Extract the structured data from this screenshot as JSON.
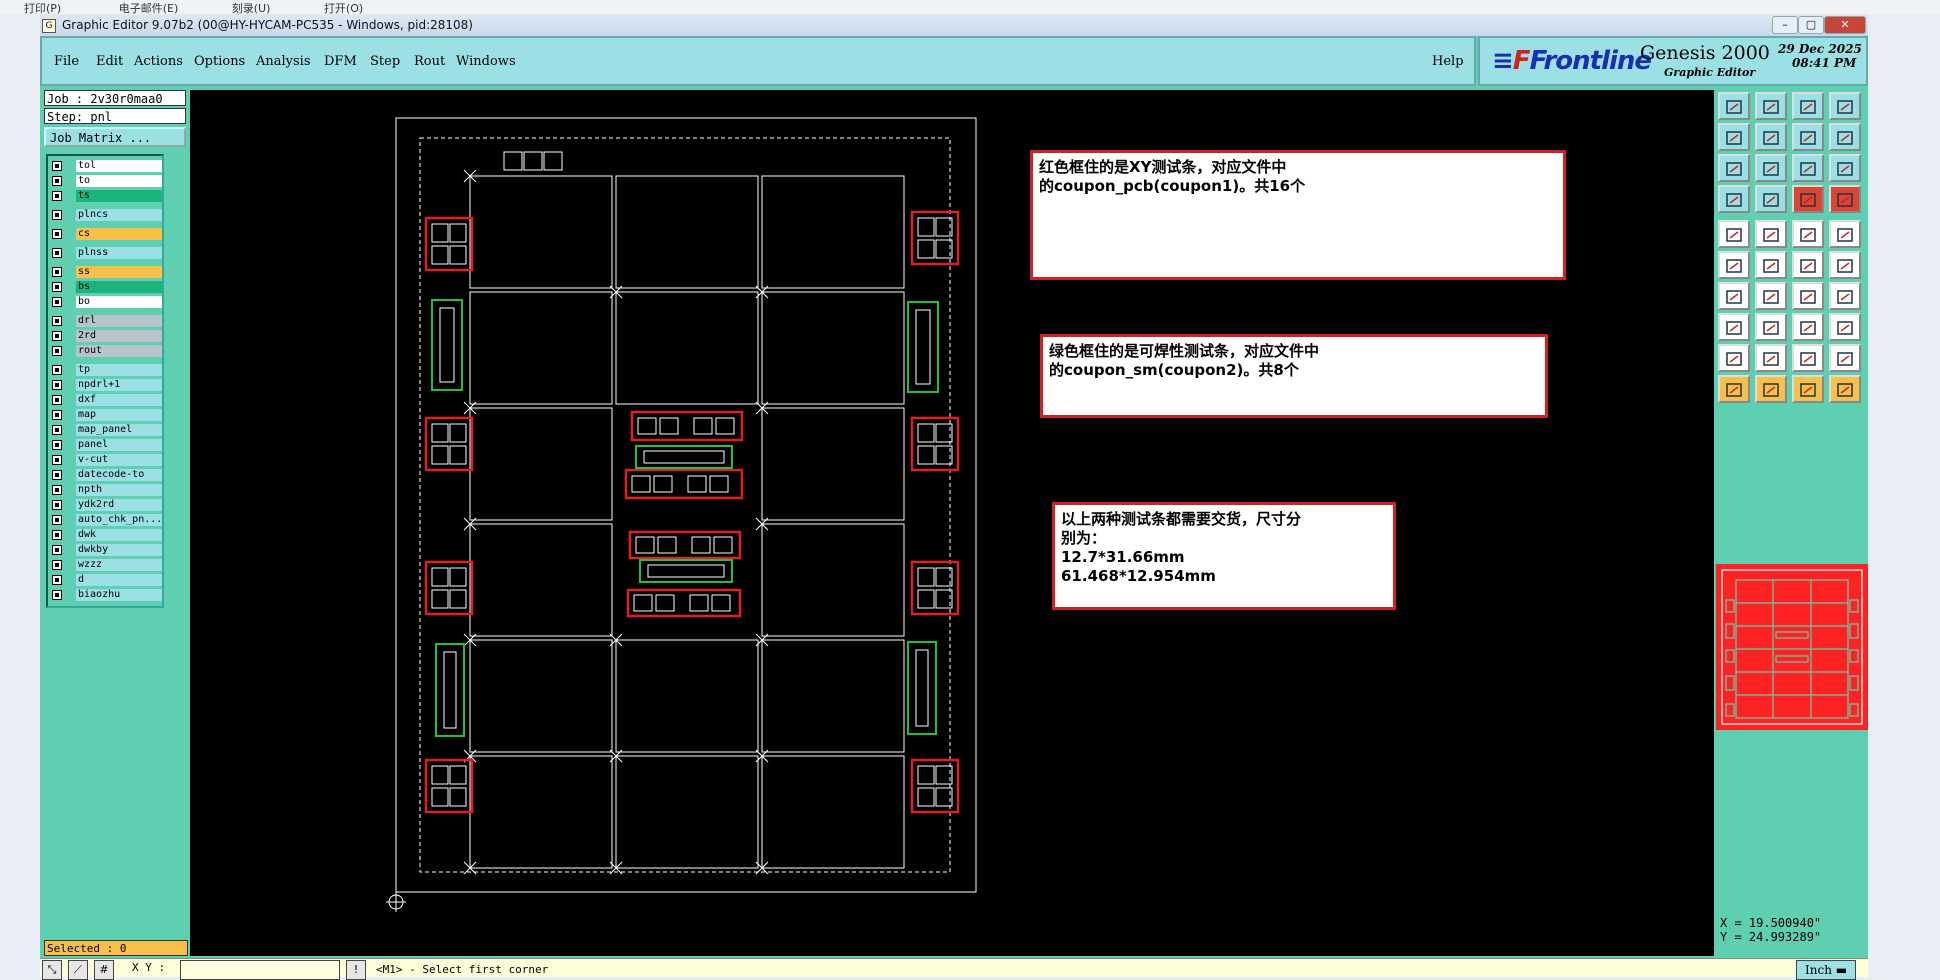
{
  "os_menu": [
    "打印(P)",
    "电子邮件(E)",
    "刻录(U)",
    "打开(O)"
  ],
  "window": {
    "title": "Graphic Editor 9.07b2 (00@HY-HYCAM-PC535 - Windows, pid:28108)"
  },
  "menu": {
    "items": [
      "File",
      "Edit",
      "Actions",
      "Options",
      "Analysis",
      "DFM",
      "Step",
      "Rout",
      "Windows"
    ],
    "help": "Help"
  },
  "logo": {
    "brand": "Frontline",
    "product": "Genesis 2000",
    "subtitle": "Graphic Editor",
    "date": "29 Dec 2025",
    "time": "08:41 PM"
  },
  "job": {
    "job_line": "Job : 2v30r0maa0",
    "step_line": "Step: pnl",
    "matrix_button": "Job Matrix ..."
  },
  "layers": [
    {
      "name": "tol",
      "color": "#ffffff"
    },
    {
      "name": "to",
      "color": "#ffffff"
    },
    {
      "name": "ts",
      "color": "#1bb57c"
    },
    {
      "name": "plncs",
      "color": "#9be0e4"
    },
    {
      "name": "cs",
      "color": "#f7c04a"
    },
    {
      "name": "plnss",
      "color": "#9be0e4"
    },
    {
      "name": "ss",
      "color": "#f7c04a"
    },
    {
      "name": "bs",
      "color": "#1bb57c"
    },
    {
      "name": "bo",
      "color": "#ffffff"
    },
    {
      "name": "drl",
      "color": "#b8c4c8"
    },
    {
      "name": "2rd",
      "color": "#b8c4c8"
    },
    {
      "name": "rout",
      "color": "#b8c4c8"
    },
    {
      "name": "tp",
      "color": "#9be0e4"
    },
    {
      "name": "npdrl+1",
      "color": "#9be0e4"
    },
    {
      "name": "dxf",
      "color": "#9be0e4"
    },
    {
      "name": "map",
      "color": "#9be0e4"
    },
    {
      "name": "map_panel",
      "color": "#9be0e4"
    },
    {
      "name": "panel",
      "color": "#9be0e4"
    },
    {
      "name": "v-cut",
      "color": "#9be0e4"
    },
    {
      "name": "datecode-to",
      "color": "#9be0e4"
    },
    {
      "name": "npth",
      "color": "#9be0e4"
    },
    {
      "name": "ydk2rd",
      "color": "#9be0e4"
    },
    {
      "name": "auto_chk_pn...",
      "color": "#9be0e4"
    },
    {
      "name": "dwk",
      "color": "#9be0e4"
    },
    {
      "name": "dwkby",
      "color": "#9be0e4"
    },
    {
      "name": "wzzz",
      "color": "#9be0e4"
    },
    {
      "name": "d",
      "color": "#9be0e4"
    },
    {
      "name": "biaozhu",
      "color": "#9be0e4"
    }
  ],
  "selected": "Selected : 0",
  "notes": {
    "note1": [
      "红色框住的是XY测试条，对应文件中",
      "的coupon_pcb(coupon1)。共16个"
    ],
    "note2": [
      "绿色框住的是可焊性测试条，对应文件中",
      "的coupon_sm(coupon2)。共8个"
    ],
    "note3": [
      "以上两种测试条都需要交货，尺寸分",
      "别为：",
      "12.7*31.66mm",
      "61.468*12.954mm"
    ]
  },
  "coords": {
    "x": "X = 19.500940\"",
    "y": "Y = 24.993289\""
  },
  "status": {
    "xy_label": "X Y :",
    "xy_value": "",
    "prompt": "<M1> - Select first corner",
    "unit": "Inch"
  }
}
